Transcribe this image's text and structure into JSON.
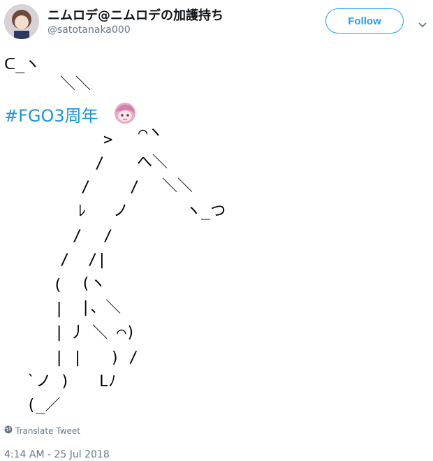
{
  "tweet": {
    "display_name": "ニムロデ@ニムロデの加護持ち",
    "handle": "@satotanaka000",
    "follow_label": "Follow",
    "hashtag": "#FGO3周年",
    "translate_label": "Translate Tweet",
    "timestamp": "4:14 AM - 25 Jul 2018",
    "ascii_art": {
      "l1": "ᑕ_ヽ",
      "l2": "＼＼",
      "l3": ">",
      "l4": "⌒ヽ",
      "l5": "/",
      "l6": "へ＼",
      "l7": "/",
      "l8": "/",
      "l9": "＼＼",
      "l10": "ﾚ",
      "l11": "ノ",
      "l12": "ヽ_つ",
      "l13": "/",
      "l14": "/",
      "l15": "/",
      "l16": "/|",
      "l17": "(",
      "l18": "(ヽ",
      "l19": "|",
      "l20": "|、＼",
      "l21": "|",
      "l22": "丿",
      "l23": "＼ ⌒)",
      "l24": "| |",
      "l25": ") /",
      "l26": "`ノ )",
      "l27": "Lﾉ",
      "l28": "(_／"
    }
  },
  "colors": {
    "accent": "#1da1f2",
    "link": "#1b95e0",
    "muted": "#657786"
  },
  "icons": {
    "caret": "chevron-down-icon",
    "globe": "globe-icon",
    "emoji": "mash-face-emoji"
  }
}
